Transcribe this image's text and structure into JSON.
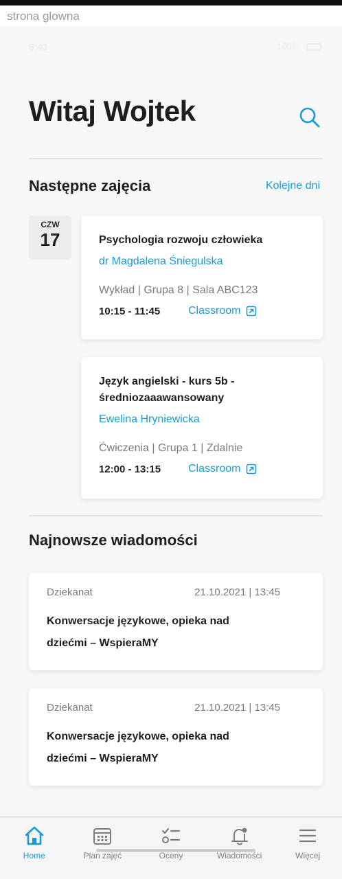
{
  "document_title": "strona glowna",
  "status": {
    "time": "9:41",
    "right": "100%"
  },
  "header": {
    "greeting": "Witaj Wojtek"
  },
  "next_classes": {
    "title": "Następne zajęcia",
    "more_link": "Kolejne dni",
    "date": {
      "dow": "CZW",
      "day": "17"
    },
    "items": [
      {
        "title": "Psychologia rozwoju człowieka",
        "teacher": "dr Magdalena Śniegulska",
        "meta": "Wykład  |  Grupa 8  |  Sala ABC123",
        "time": "10:15 - 11:45",
        "link": "Classroom"
      },
      {
        "title": "Język angielski - kurs 5b - średniozaaawansowany",
        "teacher": "Ewelina Hryniewicka",
        "meta": "Ćwiczenia  |  Grupa 1  |  Zdalnie",
        "time": "12:00 - 13:15",
        "link": "Classroom"
      }
    ]
  },
  "messages": {
    "title": "Najnowsze wiadomości",
    "items": [
      {
        "sender": "Dziekanat",
        "datetime": "21.10.2021  |  13:45",
        "subject": "Konwersacje językowe, opieka nad dziećmi – WspieraMY"
      },
      {
        "sender": "Dziekanat",
        "datetime": "21.10.2021  |  13:45",
        "subject": "Konwersacje językowe, opieka nad dziećmi – WspieraMY"
      }
    ]
  },
  "nav": {
    "items": [
      {
        "label": "Home",
        "icon": "home-icon",
        "active": true
      },
      {
        "label": "Plan zajęć",
        "icon": "calendar-icon",
        "active": false
      },
      {
        "label": "Oceny",
        "icon": "list-icon",
        "active": false
      },
      {
        "label": "Wiadomości",
        "icon": "bell-icon",
        "active": false
      },
      {
        "label": "Więcej",
        "icon": "menu-icon",
        "active": false
      }
    ]
  },
  "colors": {
    "accent": "#1a9bd6",
    "text": "#1e1e1e",
    "muted": "#7a7a7a",
    "background": "#f7f7f7"
  }
}
